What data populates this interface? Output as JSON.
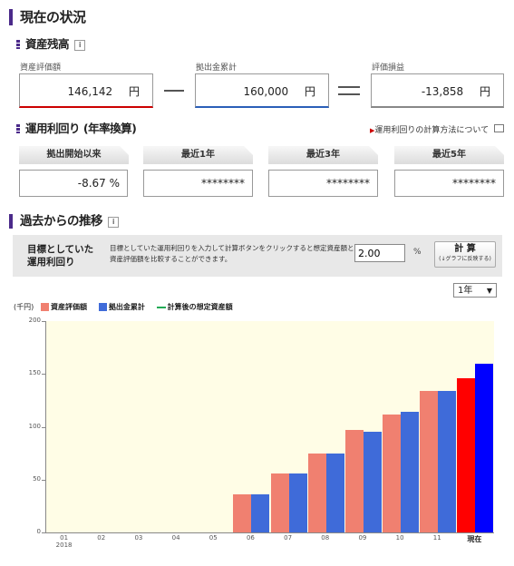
{
  "title": "現在の状況",
  "balance": {
    "heading": "資産残高",
    "info_icon": "i",
    "asset_label": "資産評価額",
    "asset_value": "146,142",
    "asset_unit": "円",
    "contrib_label": "拠出金累計",
    "contrib_value": "160,000",
    "contrib_unit": "円",
    "gain_label": "評価損益",
    "gain_value": "-13,858",
    "gain_unit": "円"
  },
  "returns": {
    "heading": "運用利回り (年率換算)",
    "calc_link": "運用利回りの計算方法について",
    "tabs": [
      {
        "label": "拠出開始以来",
        "value": "-8.67 %"
      },
      {
        "label": "最近1年",
        "value": "********"
      },
      {
        "label": "最近3年",
        "value": "********"
      },
      {
        "label": "最近5年",
        "value": "********"
      }
    ]
  },
  "history": {
    "heading": "過去からの推移",
    "info_icon": "i",
    "target_label": "目標としていた運用利回り",
    "target_desc": "目標としていた運用利回りを入力して計算ボタンをクリックすると想定資産額と資産評価額を比較することができます。",
    "target_value": "2.00",
    "target_unit": "%",
    "calc_button": "計 算",
    "calc_note": "(↓グラフに反映する)",
    "period": "1年"
  },
  "colors": {
    "asset": "#f08070",
    "contrib": "#3f6bd9",
    "now_asset": "#ff0000",
    "now_contrib": "#0000ff",
    "line": "#22aa55"
  },
  "chart_data": {
    "type": "bar",
    "unit_label": "(千円)",
    "legend": [
      "資産評価額",
      "拠出金累計",
      "計算後の想定資産額"
    ],
    "categories": [
      "01",
      "02",
      "03",
      "04",
      "05",
      "06",
      "07",
      "08",
      "09",
      "10",
      "11",
      "現在"
    ],
    "x_sublabel": "2018",
    "ylim": [
      0,
      200
    ],
    "yticks": [
      0,
      50,
      100,
      150,
      200
    ],
    "series": [
      {
        "name": "資産評価額",
        "values": [
          null,
          null,
          null,
          null,
          null,
          36,
          56,
          75,
          97,
          112,
          134,
          146
        ]
      },
      {
        "name": "拠出金累計",
        "values": [
          null,
          null,
          null,
          null,
          null,
          36,
          56,
          75,
          95,
          114,
          134,
          160
        ]
      }
    ]
  }
}
